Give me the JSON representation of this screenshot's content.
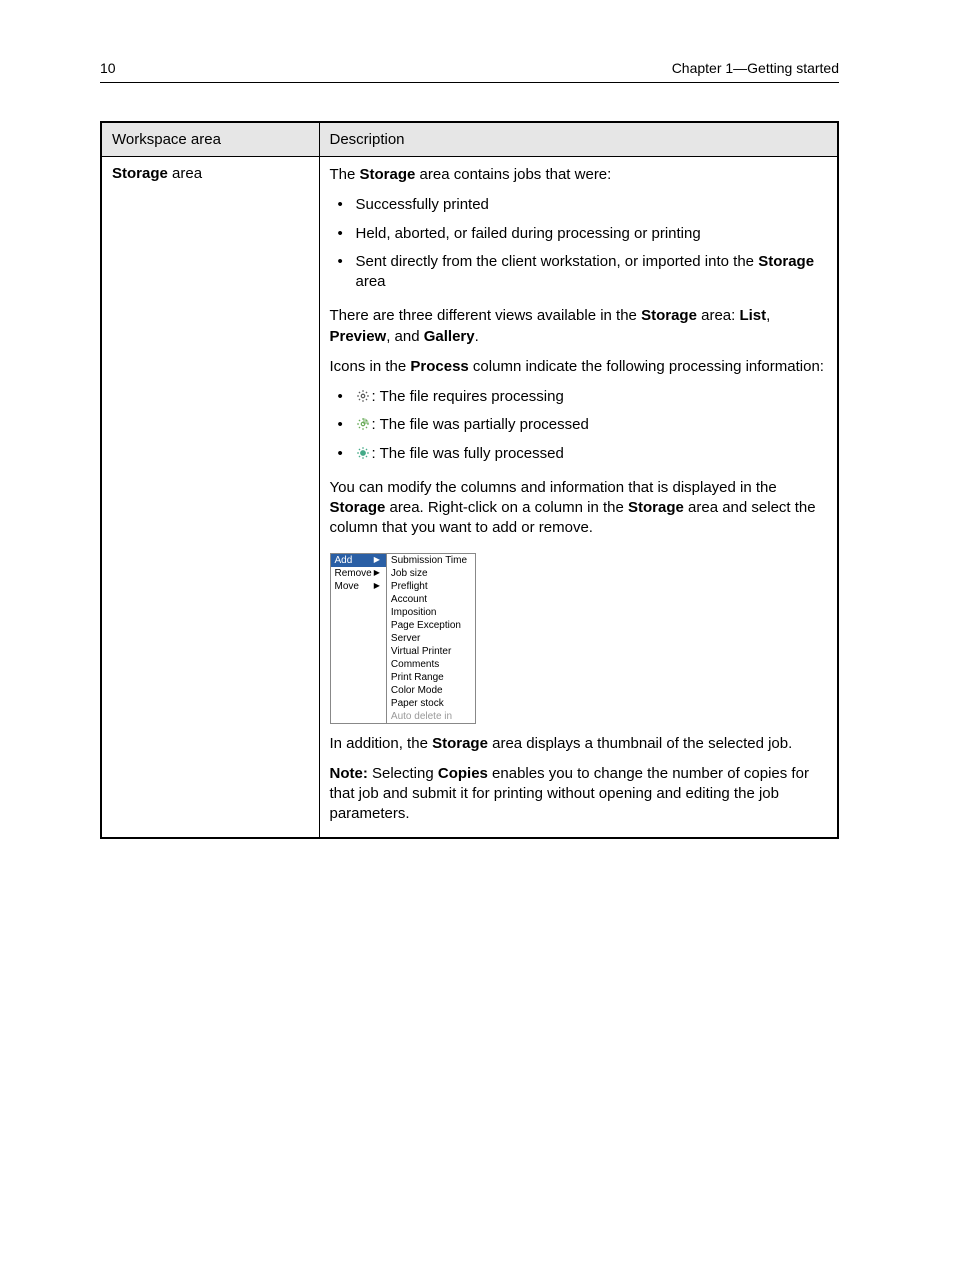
{
  "header": {
    "page_number": "10",
    "chapter": "Chapter 1—Getting started"
  },
  "table": {
    "col1_header": "Workspace area",
    "col2_header": "Description",
    "row_label_bold": "Storage",
    "row_label_rest": " area",
    "intro_pre": "The ",
    "intro_bold": "Storage",
    "intro_post": " area contains jobs that were:",
    "bullets1": {
      "b1": "Successfully printed",
      "b2": "Held, aborted, or failed during processing or printing",
      "b3_pre": "Sent directly from the client workstation, or imported into the ",
      "b3_bold": "Storage",
      "b3_post": " area"
    },
    "views": {
      "pre": "There are three different views available in the ",
      "b1": "Storage",
      "mid1": " area: ",
      "b2": "List",
      "sep1": ", ",
      "b3": "Preview",
      "sep2": ", and ",
      "b4": "Gallery",
      "post": "."
    },
    "icons_intro": {
      "pre": "Icons in the ",
      "b1": "Process",
      "post": " column indicate the following processing information:"
    },
    "icon_bullets": {
      "i1": ": The file requires processing",
      "i2": ": The file was partially processed",
      "i3": ": The file was fully processed"
    },
    "modify": {
      "pre": "You can modify the columns and information that is displayed in the ",
      "b1": "Storage",
      "mid1": " area. Right-click on a column in the ",
      "b2": "Storage",
      "post": " area and select the column that you want to add or remove."
    },
    "menu": {
      "left": {
        "add": "Add",
        "remove": "Remove",
        "move": "Move"
      },
      "right": {
        "r1": "Submission Time",
        "r2": "Job size",
        "r3": "Preflight",
        "r4": "Account",
        "r5": "Imposition",
        "r6": "Page Exception",
        "r7": "Server",
        "r8": "Virtual Printer",
        "r9": "Comments",
        "r10": "Print Range",
        "r11": "Color Mode",
        "r12": "Paper stock",
        "r13": "Auto delete in"
      }
    },
    "addition": {
      "pre": "In addition, the ",
      "b1": "Storage",
      "post": " area displays a thumbnail of the selected job."
    },
    "note": {
      "label": "Note:",
      "pre": " Selecting ",
      "b1": "Copies",
      "post": " enables you to change the number of copies for that job and submit it for printing without opening and editing the job parameters."
    }
  }
}
